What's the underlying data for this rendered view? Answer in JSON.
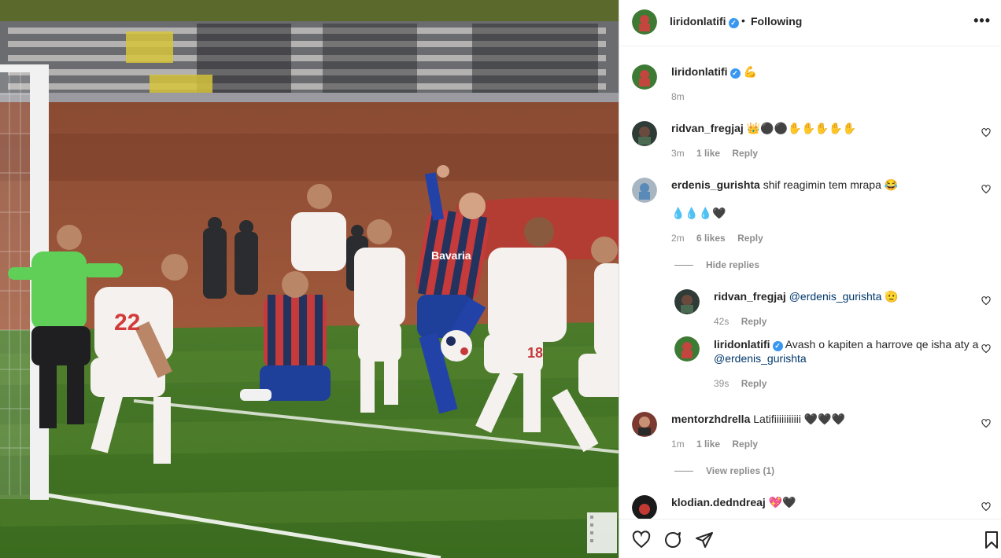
{
  "post": {
    "photo_alt": "football match photo",
    "watermark": "bookmark-outline-icon"
  },
  "header": {
    "username": "liridonlatifi",
    "dot": "•",
    "following": "Following",
    "more": "•••"
  },
  "caption": {
    "username": "liridonlatifi",
    "text": "💪",
    "time": "8m"
  },
  "comments": [
    {
      "username": "ridvan_fregjaj",
      "text": "👑⚫⚫✋✋✋✋✋",
      "time": "3m",
      "likes": "1 like",
      "reply": "Reply"
    },
    {
      "username": "erdenis_gurishta",
      "text": "shif reagimin tem mrapa 😂",
      "text2": "💧💧💧🖤",
      "time": "2m",
      "likes": "6 likes",
      "reply": "Reply",
      "toggle": "Hide replies"
    },
    {
      "username": "mentorzhdrella",
      "text": "Latifiiiiiiiiiii 🖤🖤🖤",
      "time": "1m",
      "likes": "1 like",
      "reply": "Reply",
      "toggle": "View replies (1)"
    },
    {
      "username": "klodian.dedndreaj",
      "text": "💖🖤"
    }
  ],
  "replies": [
    {
      "username": "ridvan_fregjaj",
      "mention": "@erdenis_gurishta",
      "suffix": "🫡",
      "time": "42s",
      "reply": "Reply"
    },
    {
      "username": "liridonlatifi",
      "text": "Avash o kapiten a harrove qe isha aty a",
      "mention": "@erdenis_gurishta",
      "time": "39s",
      "reply": "Reply"
    }
  ],
  "icons": {
    "like": "heart-icon",
    "comment": "comment-icon",
    "share": "share-icon",
    "save": "bookmark-icon"
  },
  "colors": {
    "verified": "#3897f0",
    "mention": "#00376b",
    "muted": "#8e8e8e"
  }
}
